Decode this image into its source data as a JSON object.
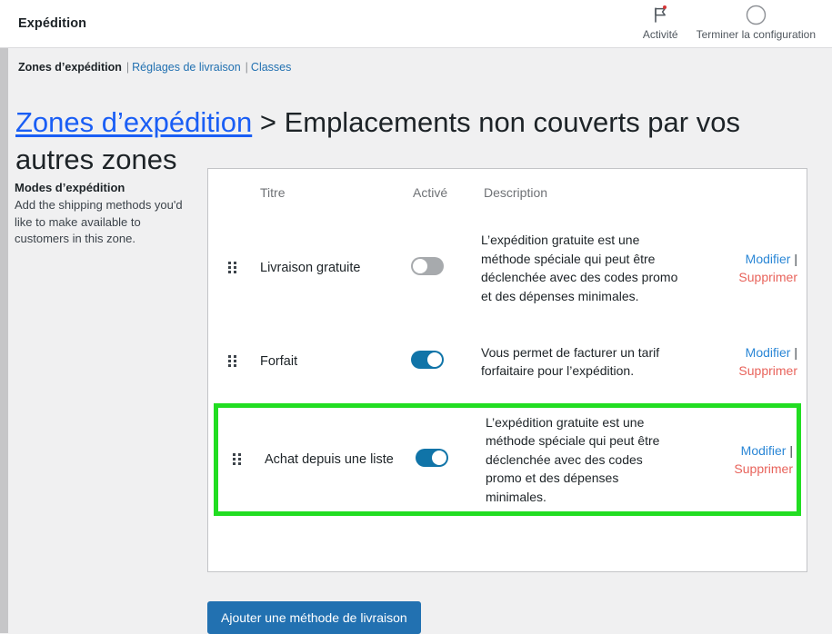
{
  "topbar": {
    "title": "Expédition",
    "actions": [
      {
        "icon": "flag-icon",
        "label": "Activité",
        "badge": true
      },
      {
        "icon": "circle-progress-icon",
        "label": "Terminer la configuration",
        "badge": false
      }
    ]
  },
  "breadcrumb": {
    "current": "Zones d’expédition",
    "links": [
      "Réglages de livraison",
      "Classes"
    ],
    "separator": "|"
  },
  "heading": {
    "link": "Zones d’expédition",
    "rest": " > Emplacements non couverts par vos autres zones"
  },
  "sidebar": {
    "title": "Modes d’expédition",
    "description": "Add the shipping methods you'd like to make available to customers in this zone."
  },
  "table": {
    "columns": [
      "Titre",
      "Activé",
      "Description"
    ],
    "rows": [
      {
        "title": "Livraison gratuite",
        "enabled": false,
        "description": "L’expédition gratuite est une méthode spéciale qui peut être déclenchée avec des codes promo et des dépenses minimales.",
        "edit_label": "Modifier",
        "separator": "|",
        "delete_label": "Supprimer",
        "highlighted": false
      },
      {
        "title": "Forfait",
        "enabled": true,
        "description": "Vous permet de facturer un tarif forfaitaire pour l’expédition.",
        "edit_label": "Modifier",
        "separator": "|",
        "delete_label": "Supprimer",
        "highlighted": false
      },
      {
        "title": "Achat depuis une liste",
        "enabled": true,
        "description": "L’expédition gratuite est une méthode spéciale qui peut être déclenchée avec des codes promo et des dépenses minimales.",
        "edit_label": "Modifier",
        "separator": "|",
        "delete_label": "Supprimer",
        "highlighted": true
      }
    ]
  },
  "footer": {
    "add_button": "Ajouter une méthode de livraison"
  },
  "colors": {
    "accent_blue": "#2271b1",
    "link_blue": "#2b87d6",
    "heading_link_blue": "#1a5ef5",
    "delete_red": "#e8635b",
    "toggle_on": "#1074a8",
    "toggle_off": "#a7aaad",
    "highlight_green": "#22dd22",
    "page_background": "#f0f0f1",
    "badge_red": "#d63638"
  }
}
